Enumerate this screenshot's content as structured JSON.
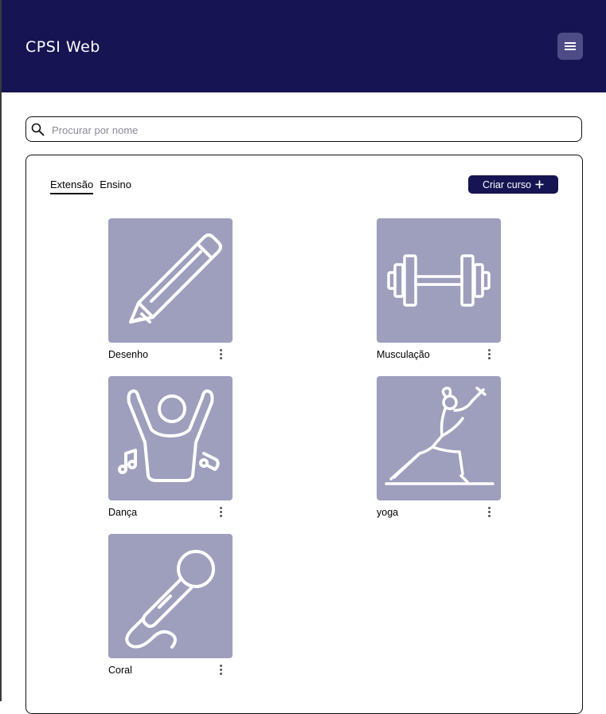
{
  "header": {
    "title": "CPSI Web",
    "menu_icon": "hamburger-menu-icon"
  },
  "search": {
    "placeholder": "Procurar por nome",
    "value": ""
  },
  "tabs": [
    {
      "label": "Extensão",
      "active": true
    },
    {
      "label": "Ensino",
      "active": false
    }
  ],
  "create_button": {
    "label": "Criar curso",
    "icon": "plus-icon"
  },
  "courses": [
    {
      "name": "Desenho",
      "icon": "pencil-icon"
    },
    {
      "name": "Musculação",
      "icon": "dumbbell-icon"
    },
    {
      "name": "Dança",
      "icon": "dancer-icon"
    },
    {
      "name": "yoga",
      "icon": "yoga-pose-icon"
    },
    {
      "name": "Coral",
      "icon": "microphone-icon"
    }
  ],
  "colors": {
    "header_bg": "#161452",
    "menu_button_bg": "#4e4c86",
    "card_bg": "#9e9ebd",
    "button_bg": "#161452"
  }
}
